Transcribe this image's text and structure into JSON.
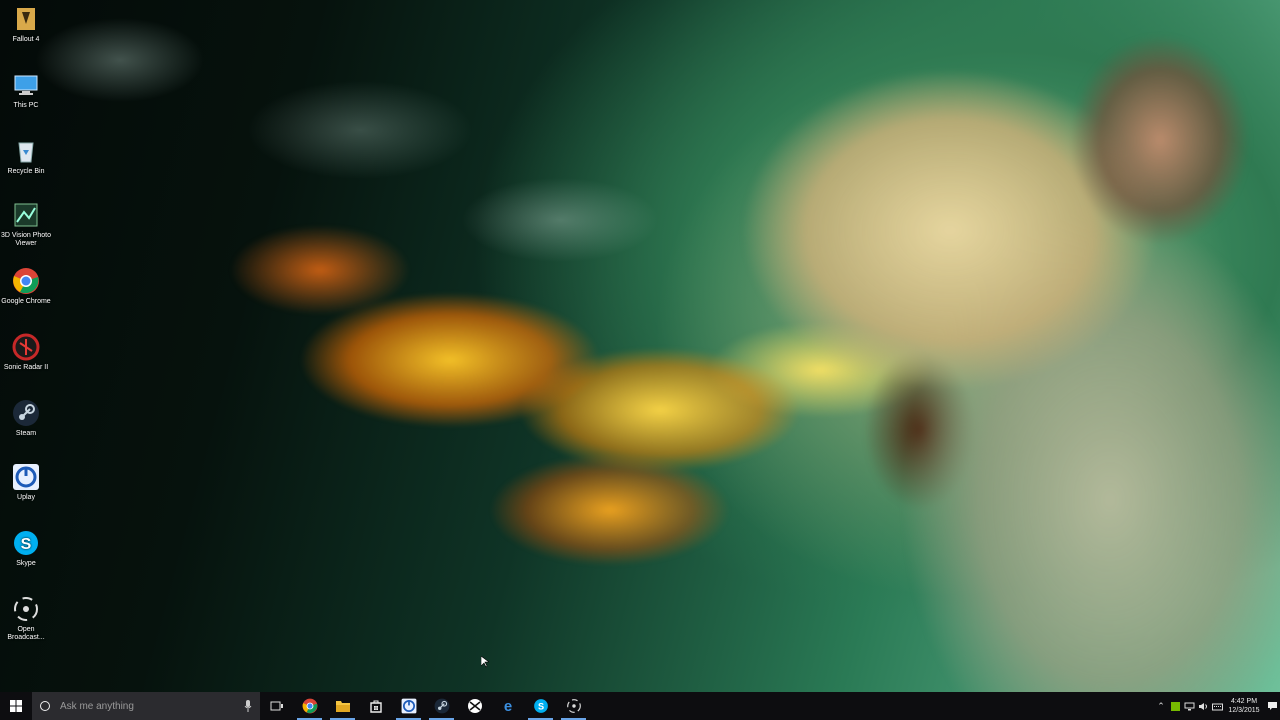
{
  "desktop": {
    "icons": [
      {
        "id": "new-game",
        "label": "Fallout 4",
        "icon": "shortcut-icon"
      },
      {
        "id": "this-pc",
        "label": "This PC",
        "icon": "computer-icon"
      },
      {
        "id": "recycle-bin",
        "label": "Recycle Bin",
        "icon": "recycle-bin-icon"
      },
      {
        "id": "3d-vision",
        "label": "3D Vision Photo Viewer",
        "icon": "photo-viewer-icon"
      },
      {
        "id": "chrome",
        "label": "Google Chrome",
        "icon": "chrome-icon"
      },
      {
        "id": "sonic-radar",
        "label": "Sonic Radar II",
        "icon": "sonic-radar-icon"
      },
      {
        "id": "steam",
        "label": "Steam",
        "icon": "steam-icon"
      },
      {
        "id": "uplay",
        "label": "Uplay",
        "icon": "uplay-icon"
      },
      {
        "id": "skype",
        "label": "Skype",
        "icon": "skype-icon"
      },
      {
        "id": "obs",
        "label": "Open Broadcast...",
        "icon": "obs-icon"
      }
    ]
  },
  "taskbar": {
    "search_placeholder": "Ask me anything",
    "apps": [
      "task-view-icon",
      "chrome-icon",
      "file-explorer-icon",
      "store-icon",
      "uplay-icon",
      "steam-icon",
      "xbox-icon",
      "edge-icon",
      "skype-icon",
      "obs-icon"
    ],
    "tray": {
      "time": "4:42 PM",
      "date": "12/3/2015"
    }
  },
  "colors": {
    "taskbar_bg": "#0d0d10",
    "search_bg": "#2b2b2f",
    "accent": "#6aa5e8"
  }
}
